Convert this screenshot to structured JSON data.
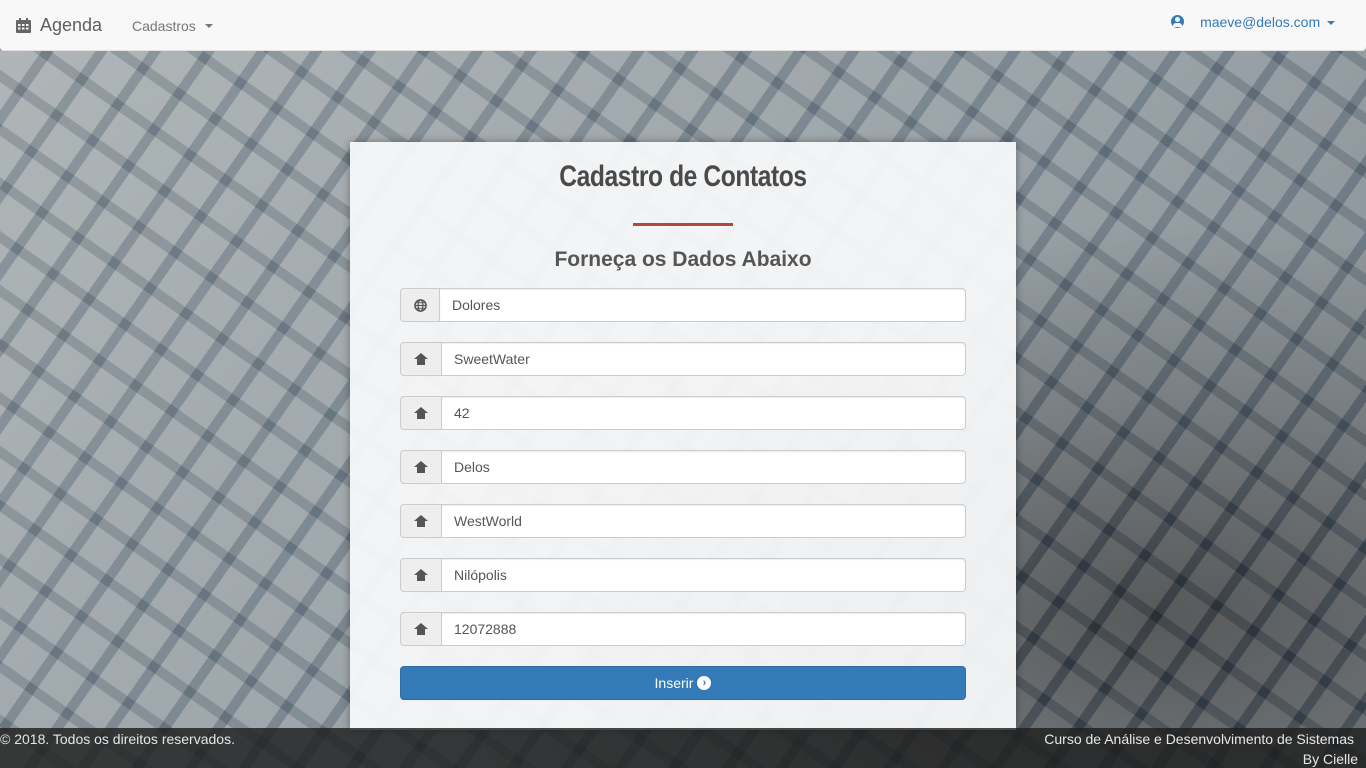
{
  "navbar": {
    "brand": "Agenda",
    "brand_icon": "calendar-icon",
    "menu_label": "Cadastros",
    "user_email": "maeve@delos.com",
    "user_icon": "user-circle-icon"
  },
  "form": {
    "title": "Cadastro de Contatos",
    "subtitle": "Forneça os Dados Abaixo",
    "accent_color": "#b0483d",
    "fields": [
      {
        "icon": "globe-icon",
        "value": "Dolores"
      },
      {
        "icon": "home-icon",
        "value": "SweetWater"
      },
      {
        "icon": "home-icon",
        "value": "42"
      },
      {
        "icon": "home-icon",
        "value": "Delos"
      },
      {
        "icon": "home-icon",
        "value": "WestWorld"
      },
      {
        "icon": "home-icon",
        "value": "Nilópolis"
      },
      {
        "icon": "home-icon",
        "value": "12072888"
      }
    ],
    "submit_label": "Inserir",
    "submit_icon": "chevron-circle-right-icon",
    "submit_color": "#337ab7"
  },
  "footer": {
    "copyright": "© 2018. Todos os direitos reservados.",
    "course": "Curso de Análise e Desenvolvimento de Sistemas",
    "credit": "By Cielle"
  }
}
